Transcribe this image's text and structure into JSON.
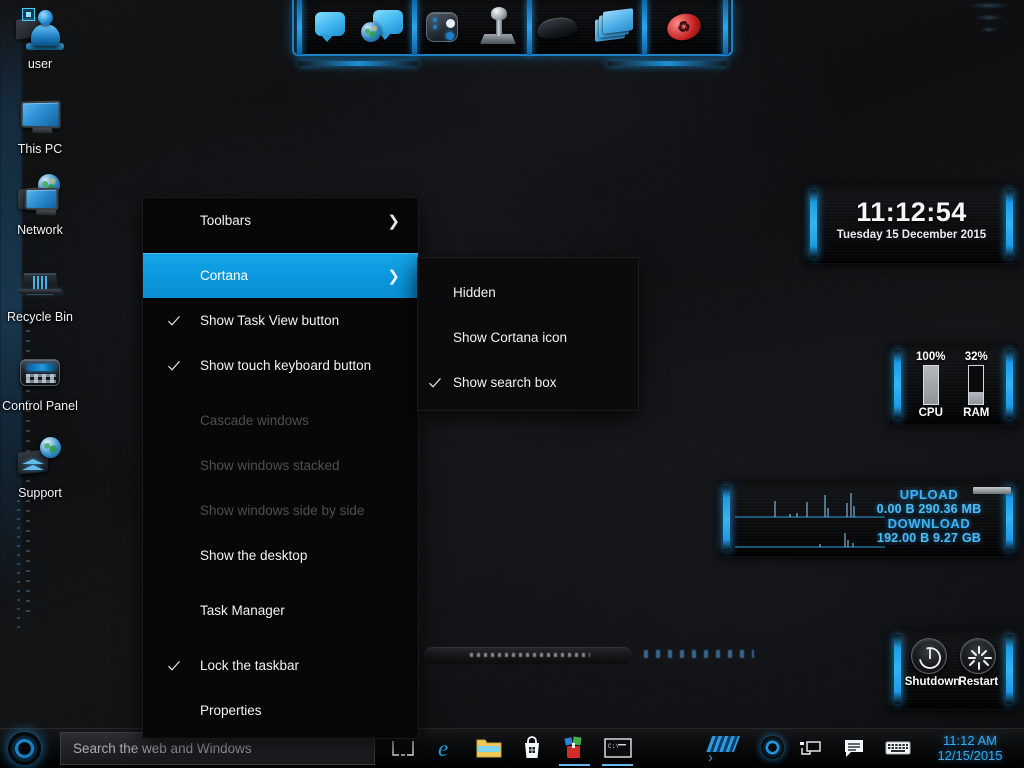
{
  "desktop": {
    "icons": [
      {
        "label": "user",
        "icon": "user-account-icon",
        "selected": true
      },
      {
        "label": "This PC",
        "icon": "this-pc-icon",
        "selected": false
      },
      {
        "label": "Network",
        "icon": "network-icon",
        "selected": false
      },
      {
        "label": "Recycle Bin",
        "icon": "recycle-bin-icon",
        "selected": false
      },
      {
        "label": "Control Panel",
        "icon": "control-panel-icon",
        "selected": false
      },
      {
        "label": "Support",
        "icon": "support-icon",
        "selected": false
      }
    ]
  },
  "top_dock": {
    "groups": [
      {
        "items": [
          {
            "icon": "chat-bubble-icon"
          },
          {
            "icon": "chat-globe-icon"
          }
        ]
      },
      {
        "items": [
          {
            "icon": "gamepad-icon"
          },
          {
            "icon": "joystick-icon"
          }
        ]
      },
      {
        "items": [
          {
            "icon": "mouse-icon"
          },
          {
            "icon": "folders-icon"
          }
        ]
      },
      {
        "items": [
          {
            "icon": "recycle-red-icon"
          }
        ]
      }
    ]
  },
  "context_menu": {
    "items": [
      {
        "label": "Toolbars",
        "checked": false,
        "submenu": true,
        "disabled": false,
        "selected": false,
        "gap_after": true
      },
      {
        "label": "Cortana",
        "checked": false,
        "submenu": true,
        "disabled": false,
        "selected": true,
        "gap_after": false
      },
      {
        "label": "Show Task View button",
        "checked": true,
        "submenu": false,
        "disabled": false,
        "selected": false,
        "gap_after": false
      },
      {
        "label": "Show touch keyboard button",
        "checked": true,
        "submenu": false,
        "disabled": false,
        "selected": false,
        "gap_after": true
      },
      {
        "label": "Cascade windows",
        "checked": false,
        "submenu": false,
        "disabled": true,
        "selected": false,
        "gap_after": false
      },
      {
        "label": "Show windows stacked",
        "checked": false,
        "submenu": false,
        "disabled": true,
        "selected": false,
        "gap_after": false
      },
      {
        "label": "Show windows side by side",
        "checked": false,
        "submenu": false,
        "disabled": true,
        "selected": false,
        "gap_after": false
      },
      {
        "label": "Show the desktop",
        "checked": false,
        "submenu": false,
        "disabled": false,
        "selected": false,
        "gap_after": true
      },
      {
        "label": "Task Manager",
        "checked": false,
        "submenu": false,
        "disabled": false,
        "selected": false,
        "gap_after": true
      },
      {
        "label": "Lock the taskbar",
        "checked": true,
        "submenu": false,
        "disabled": false,
        "selected": false,
        "gap_after": false
      },
      {
        "label": "Properties",
        "checked": false,
        "submenu": false,
        "disabled": false,
        "selected": false,
        "gap_after": false
      }
    ],
    "highlight_color": "#0b97dd"
  },
  "cortana_submenu": {
    "items": [
      {
        "label": "Hidden",
        "checked": false
      },
      {
        "label": "Show Cortana icon",
        "checked": false
      },
      {
        "label": "Show search box",
        "checked": true
      }
    ]
  },
  "widgets": {
    "clock": {
      "time": "11:12:54",
      "date": "Tuesday 15 December 2015"
    },
    "system": {
      "gauges": [
        {
          "name": "CPU",
          "percent_label": "100%",
          "percent": 100
        },
        {
          "name": "RAM",
          "percent_label": "32%",
          "percent": 32
        }
      ]
    },
    "network": {
      "upload_label": "UPLOAD",
      "upload_rate": "0.00 B",
      "upload_total": "290.36 MB",
      "download_label": "DOWNLOAD",
      "download_rate": "192.00 B",
      "download_total": "9.27 GB",
      "accent": "#3bb4f5"
    },
    "power": {
      "buttons": [
        {
          "label": "Shutdown",
          "icon": "power-icon"
        },
        {
          "label": "Restart",
          "icon": "restart-icon"
        }
      ]
    }
  },
  "taskbar": {
    "start": {
      "icon": "start-orb-icon"
    },
    "search": {
      "placeholder": "Search the web and Windows",
      "value": ""
    },
    "items": [
      {
        "name": "task-view",
        "icon": "task-view-icon",
        "running": false
      },
      {
        "name": "edge",
        "icon": "edge-icon",
        "running": false
      },
      {
        "name": "file-explorer",
        "icon": "file-explorer-icon",
        "running": false
      },
      {
        "name": "store",
        "icon": "store-icon",
        "running": false
      },
      {
        "name": "pinned-app",
        "icon": "app-icon",
        "running": true
      },
      {
        "name": "console",
        "icon": "console-icon",
        "running": true
      }
    ],
    "tray": [
      {
        "name": "tray-network",
        "icon": "network-tray-icon"
      },
      {
        "name": "tray-action-center",
        "icon": "action-center-icon"
      },
      {
        "name": "tray-keyboard",
        "icon": "keyboard-icon"
      }
    ],
    "clock": {
      "time": "11:12 AM",
      "date": "12/15/2015"
    }
  }
}
